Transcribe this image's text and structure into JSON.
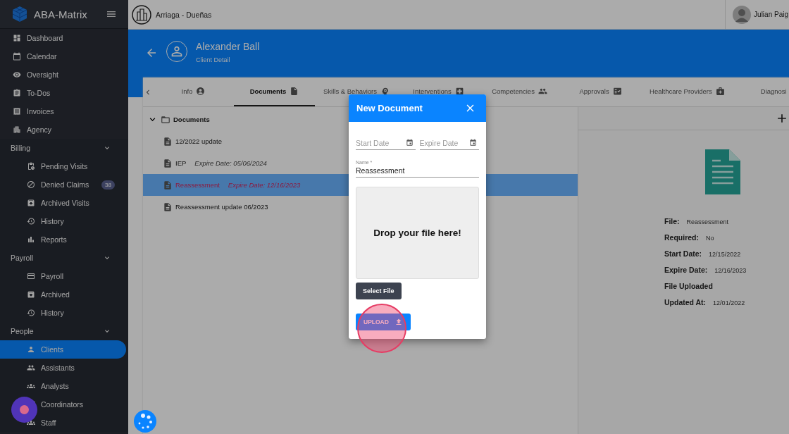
{
  "sidebar": {
    "brand": "ABA-Matrix",
    "nav": [
      {
        "label": "Dashboard",
        "selected": false
      },
      {
        "label": "Calendar",
        "selected": false
      },
      {
        "label": "Oversight",
        "selected": false
      },
      {
        "label": "To-Dos",
        "selected": false
      },
      {
        "label": "Invoices",
        "selected": false
      },
      {
        "label": "Agency",
        "selected": false
      }
    ],
    "sections": [
      {
        "label": "Billing",
        "expanded": true,
        "children": [
          {
            "label": "Pending Visits",
            "selected": false
          },
          {
            "label": "Denied Claims",
            "selected": false,
            "badge": "38"
          },
          {
            "label": "Archived Visits",
            "selected": false
          },
          {
            "label": "History",
            "selected": false
          },
          {
            "label": "Reports",
            "selected": false
          }
        ]
      },
      {
        "label": "Payroll",
        "expanded": true,
        "children": [
          {
            "label": "Payroll",
            "selected": false
          },
          {
            "label": "Archived",
            "selected": false
          },
          {
            "label": "History",
            "selected": false
          }
        ]
      },
      {
        "label": "People",
        "expanded": true,
        "children": [
          {
            "label": "Clients",
            "selected": true
          },
          {
            "label": "Assistants",
            "selected": false
          },
          {
            "label": "Analysts",
            "selected": false
          },
          {
            "label": "Coordinators",
            "selected": false
          },
          {
            "label": "Staff",
            "selected": false
          }
        ]
      }
    ]
  },
  "topbar": {
    "organization": "Arriaga - Dueñas",
    "user": "Julian Paig"
  },
  "header": {
    "title": "Alexander Ball",
    "subtitle": "Client Detail"
  },
  "tabs": [
    {
      "label": "Info",
      "selected": false
    },
    {
      "label": "Documents",
      "selected": true
    },
    {
      "label": "Skills & Behaviors",
      "selected": false
    },
    {
      "label": "Interventions",
      "selected": false
    },
    {
      "label": "Competencies",
      "selected": false
    },
    {
      "label": "Approvals",
      "selected": false
    },
    {
      "label": "Healthcare Providers",
      "selected": false
    },
    {
      "label": "Diagnosi",
      "selected": false
    }
  ],
  "tree": {
    "label": "Documents",
    "expanded": true,
    "children": [
      {
        "name": "12/2022 update",
        "selected": false
      },
      {
        "name": "IEP",
        "expire": "Expire Date: 05/06/2024",
        "selected": false
      },
      {
        "name": "Reassessment",
        "expire": "Expire Date: 12/16/2023",
        "selected": true
      },
      {
        "name": "Reassessment update 06/2023",
        "selected": false
      }
    ]
  },
  "details": [
    {
      "label": "File:",
      "value": "Reassessment"
    },
    {
      "label": "Required:",
      "value": "No"
    },
    {
      "label": "Start Date:",
      "value": "12/15/2022"
    },
    {
      "label": "Expire Date:",
      "value": "12/16/2023"
    },
    {
      "label": "File Uploaded"
    },
    {
      "label": "Updated At:",
      "value": "12/01/2022"
    }
  ],
  "dialog": {
    "title": "New Document",
    "start_date": {
      "placeholder": "Start Date"
    },
    "expire_date": {
      "placeholder": "Expire Date"
    },
    "name": {
      "label": "Name *",
      "value": "Reassessment"
    },
    "dropzone": "Drop your file here!",
    "select_button": "Select File",
    "upload_button": "UPLOAD"
  }
}
